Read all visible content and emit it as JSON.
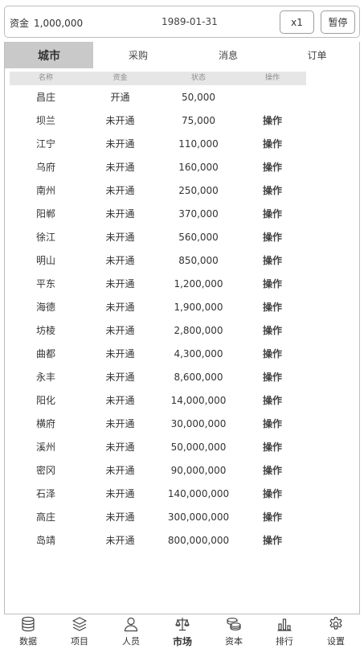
{
  "header": {
    "funds_label": "资金",
    "funds_value": "1,000,000",
    "date": "1989-01-31",
    "speed_label": "x1",
    "pause_label": "暂停"
  },
  "tabs": [
    {
      "label": "城市",
      "active": true
    },
    {
      "label": "采购",
      "active": false
    },
    {
      "label": "消息",
      "active": false
    },
    {
      "label": "订单",
      "active": false
    }
  ],
  "table": {
    "columns": [
      "名称",
      "资金",
      "状态",
      "操作"
    ],
    "rows": [
      {
        "name": "昌庄",
        "status": "开通",
        "funds": "50,000",
        "action": ""
      },
      {
        "name": "坝兰",
        "status": "未开通",
        "funds": "75,000",
        "action": "操作"
      },
      {
        "name": "江宁",
        "status": "未开通",
        "funds": "110,000",
        "action": "操作"
      },
      {
        "name": "乌府",
        "status": "未开通",
        "funds": "160,000",
        "action": "操作"
      },
      {
        "name": "南州",
        "status": "未开通",
        "funds": "250,000",
        "action": "操作"
      },
      {
        "name": "阳郸",
        "status": "未开通",
        "funds": "370,000",
        "action": "操作"
      },
      {
        "name": "徐江",
        "status": "未开通",
        "funds": "560,000",
        "action": "操作"
      },
      {
        "name": "明山",
        "status": "未开通",
        "funds": "850,000",
        "action": "操作"
      },
      {
        "name": "平东",
        "status": "未开通",
        "funds": "1,200,000",
        "action": "操作"
      },
      {
        "name": "海德",
        "status": "未开通",
        "funds": "1,900,000",
        "action": "操作"
      },
      {
        "name": "坊棱",
        "status": "未开通",
        "funds": "2,800,000",
        "action": "操作"
      },
      {
        "name": "曲都",
        "status": "未开通",
        "funds": "4,300,000",
        "action": "操作"
      },
      {
        "name": "永丰",
        "status": "未开通",
        "funds": "8,600,000",
        "action": "操作"
      },
      {
        "name": "阳化",
        "status": "未开通",
        "funds": "14,000,000",
        "action": "操作"
      },
      {
        "name": "横府",
        "status": "未开通",
        "funds": "30,000,000",
        "action": "操作"
      },
      {
        "name": "溪州",
        "status": "未开通",
        "funds": "50,000,000",
        "action": "操作"
      },
      {
        "name": "密冈",
        "status": "未开通",
        "funds": "90,000,000",
        "action": "操作"
      },
      {
        "name": "石泽",
        "status": "未开通",
        "funds": "140,000,000",
        "action": "操作"
      },
      {
        "name": "高庄",
        "status": "未开通",
        "funds": "300,000,000",
        "action": "操作"
      },
      {
        "name": "岛靖",
        "status": "未开通",
        "funds": "800,000,000",
        "action": "操作"
      }
    ]
  },
  "nav": [
    {
      "label": "数据",
      "icon": "database-icon",
      "active": false
    },
    {
      "label": "项目",
      "icon": "layers-icon",
      "active": false
    },
    {
      "label": "人员",
      "icon": "person-icon",
      "active": false
    },
    {
      "label": "市场",
      "icon": "scale-icon",
      "active": true
    },
    {
      "label": "资本",
      "icon": "coins-icon",
      "active": false
    },
    {
      "label": "排行",
      "icon": "bar-chart-icon",
      "active": false
    },
    {
      "label": "设置",
      "icon": "gear-icon",
      "active": false
    }
  ]
}
